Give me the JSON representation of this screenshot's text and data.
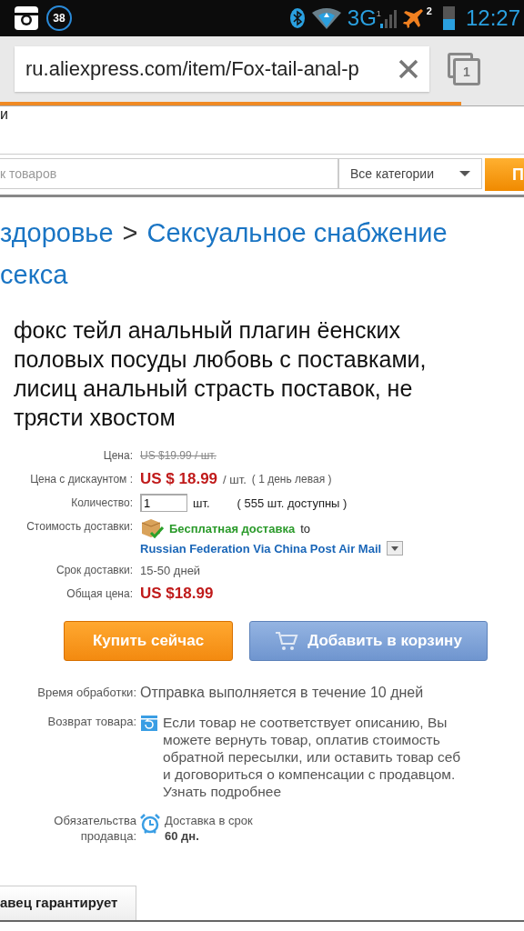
{
  "status_bar": {
    "notification_count": "38",
    "network": "3G",
    "sim1": "1",
    "sim2": "2",
    "time": "12:27"
  },
  "browser": {
    "url": "ru.aliexpress.com/item/Fox-tail-anal-p",
    "tab_count": "1"
  },
  "page": {
    "top_fragment": "и",
    "search": {
      "placeholder": "к товаров",
      "category": "Все категории",
      "button": "П"
    },
    "breadcrumb": [
      {
        "text": "здоровье",
        "kind": "link"
      },
      {
        "text": ">",
        "kind": "separator"
      },
      {
        "text": "Сексуальное снабжение",
        "kind": "link"
      },
      {
        "text": "секса",
        "kind": "link"
      }
    ],
    "title": "фокс тейл анальный плагин ёенских половых посуды любовь с поставками, лисиц анальный страсть поставок, не трясти хвостом",
    "price_label": "Цена:",
    "old_price": "US $19.99 / шт.",
    "discount_label": "Цена с дискаунтом :",
    "discount_price": "US $ 18.99",
    "unit": "/ шт.",
    "discount_note": "( 1 день левая )",
    "quantity_label": "Количество:",
    "quantity": "1",
    "quantity_unit": "шт.",
    "available": "( 555 шт. доступны )",
    "shipping_label": "Стоимость доставки:",
    "free_shipping": "Бесплатная доставка",
    "to": "to",
    "shipping_method": "Russian Federation Via China Post Air Mail",
    "delivery_label": "Срок доставки:",
    "delivery_time": "15-50 дней",
    "total_label": "Общая цена:",
    "total": "US $18.99",
    "buy_button": "Купить сейчас",
    "cart_button": "Добавить в корзину",
    "processing_label": "Время обработки:",
    "processing": "Отправка выполняется в течение 10 дней",
    "return_label": "Возврат товара:",
    "return_lines": [
      "Если товар не соответствует описанию, Вы",
      "можете вернуть товар, оплатив стоимость",
      "обратной пересылки, или оставить товар себ",
      "и договориться о компенсации с продавцом."
    ],
    "return_link": "Узнать подробнее",
    "seller_label_lines": [
      "Обязательства",
      "продавца:"
    ],
    "seller_promise": "Доставка в срок",
    "seller_days": "60 дн.",
    "tab": "авец гарантирует"
  }
}
